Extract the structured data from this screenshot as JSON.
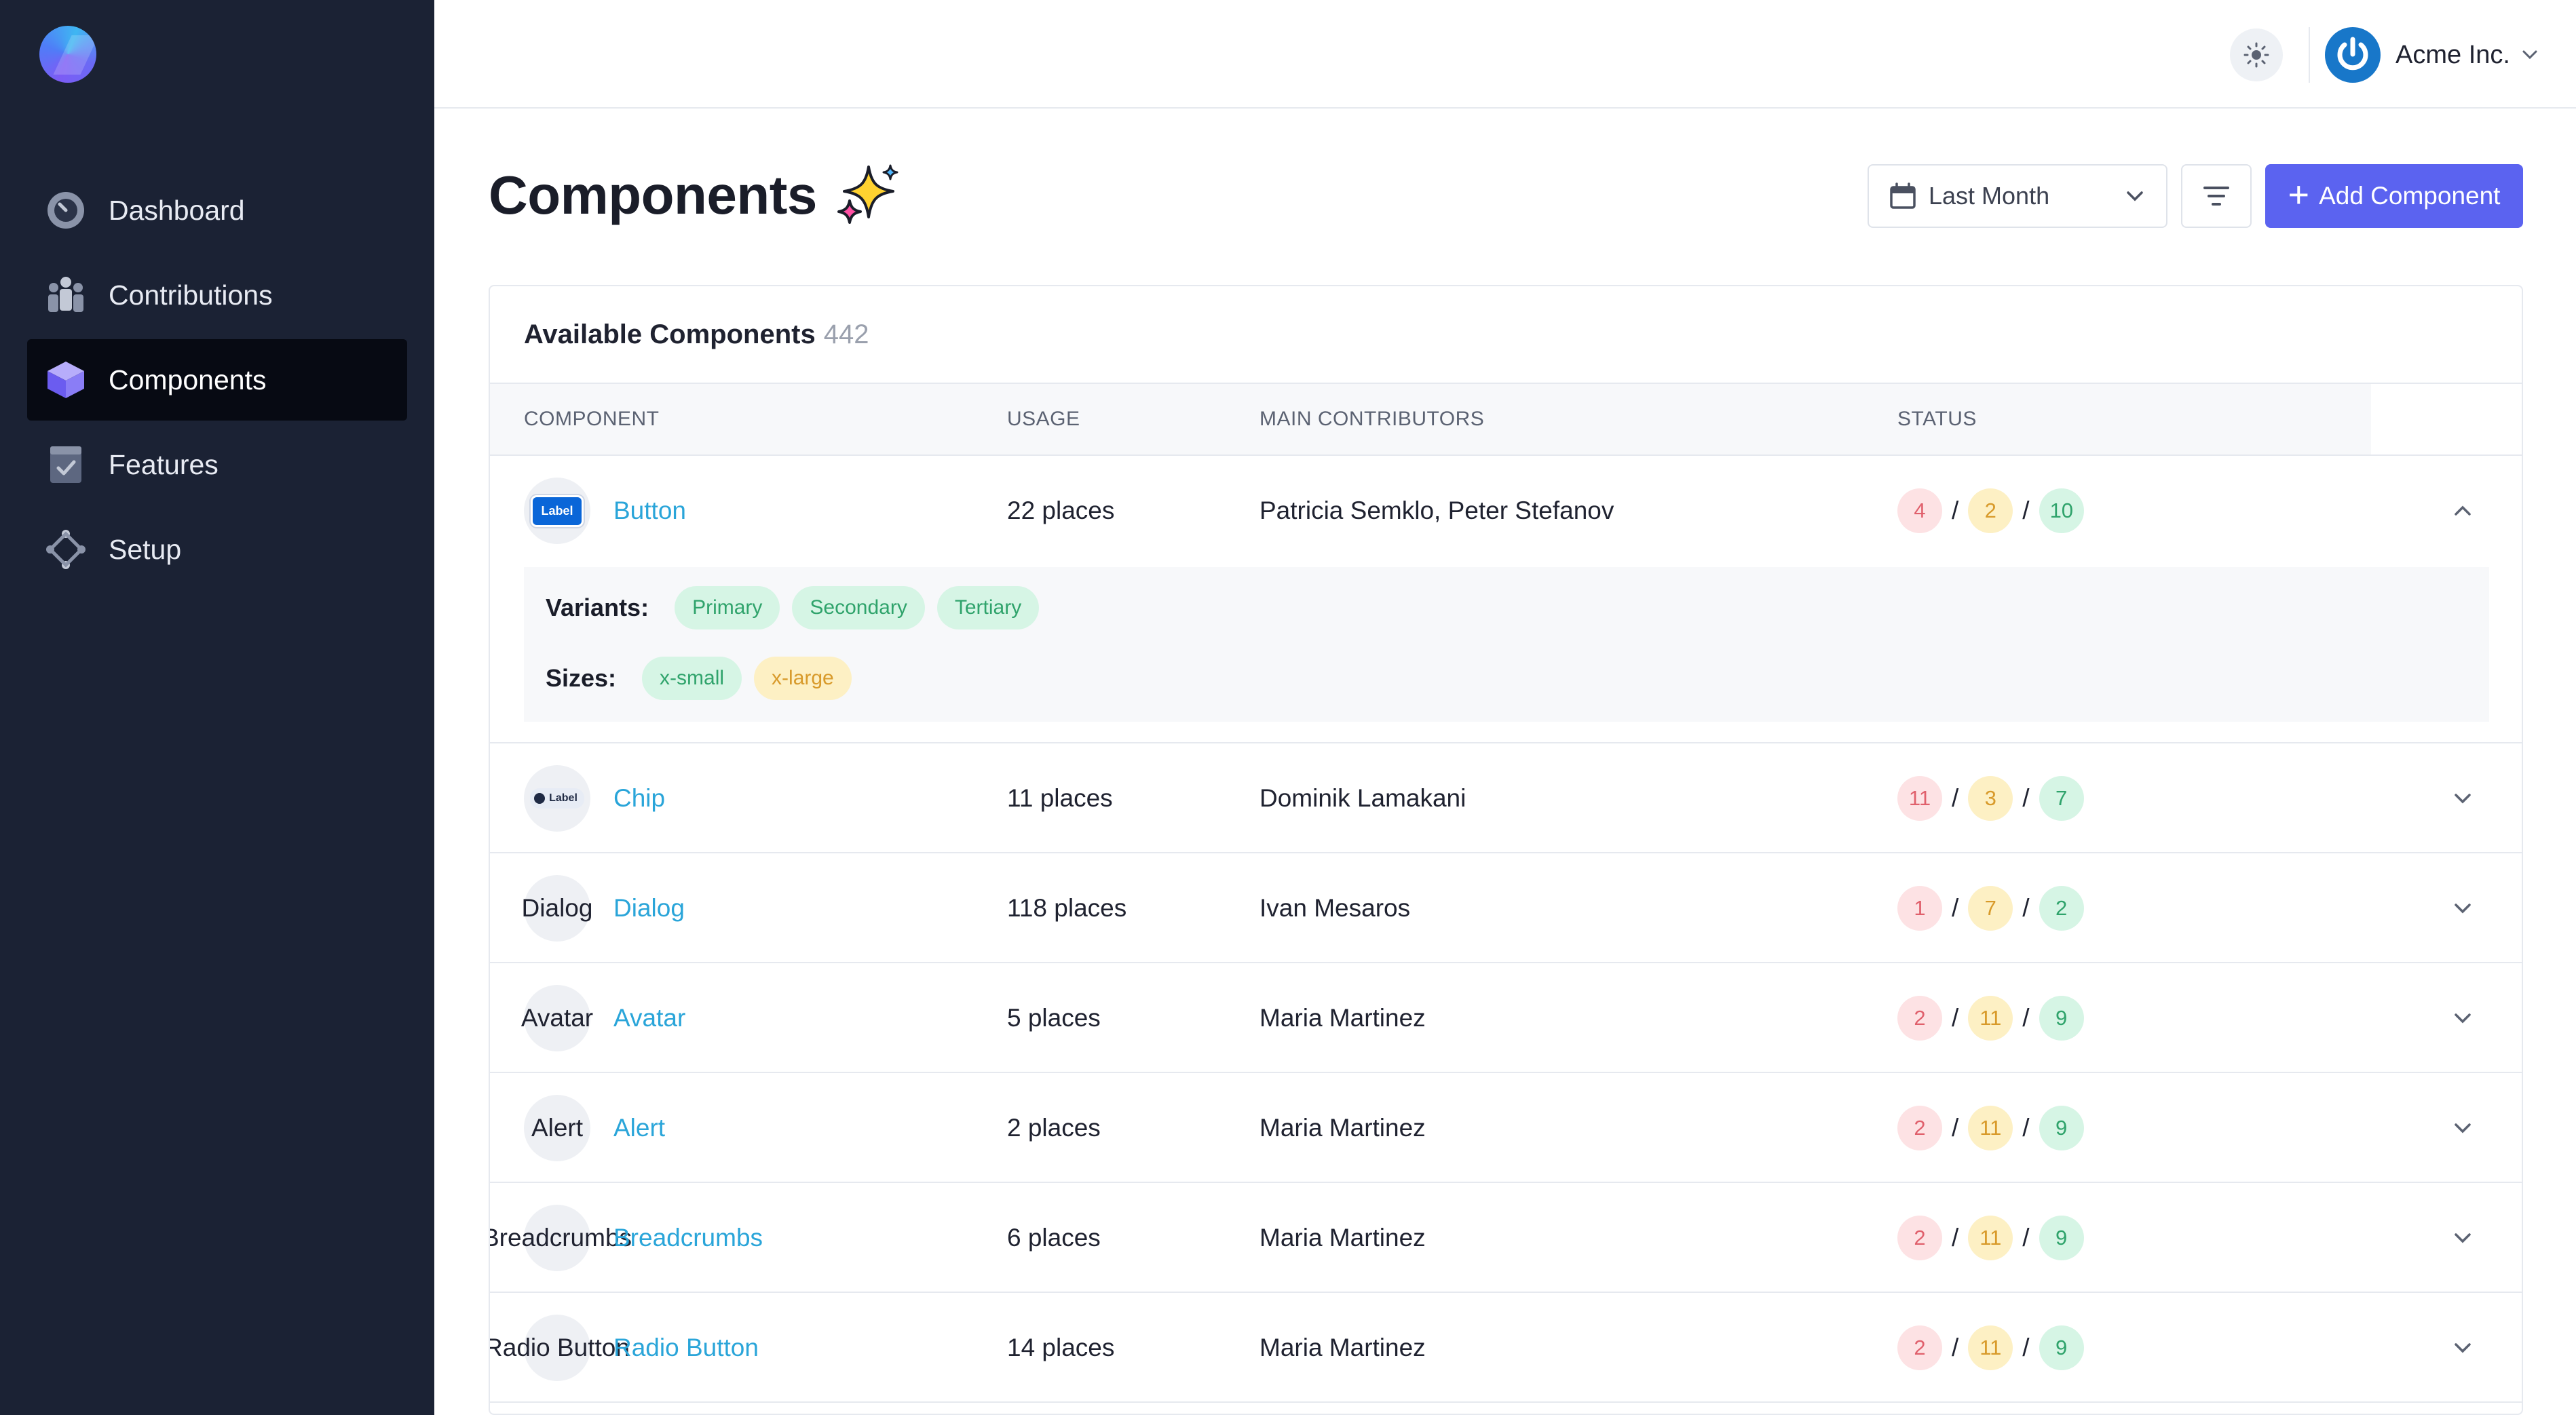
{
  "sidebar": {
    "items": [
      {
        "label": "Dashboard",
        "icon": "dashboard-gauge-icon",
        "active": false
      },
      {
        "label": "Contributions",
        "icon": "contributors-people-icon",
        "active": false
      },
      {
        "label": "Components",
        "icon": "components-cube-icon",
        "active": true
      },
      {
        "label": "Features",
        "icon": "features-checklist-icon",
        "active": false
      },
      {
        "label": "Setup",
        "icon": "setup-diamond-icon",
        "active": false
      }
    ]
  },
  "header": {
    "account_name": "Acme Inc."
  },
  "page": {
    "title": "Components",
    "date_filter": "Last Month",
    "add_button": "Add Component"
  },
  "card": {
    "title": "Available Components",
    "count": "442",
    "columns": {
      "component": "COMPONENT",
      "usage": "USAGE",
      "contributors": "MAIN CONTRIBUTORS",
      "status": "STATUS"
    },
    "rows": [
      {
        "thumb": "Label",
        "name": "Button",
        "usage": "22 places",
        "contributors": "Patricia Semklo, Peter Stefanov",
        "status": [
          "4",
          "2",
          "10"
        ],
        "expanded": true
      },
      {
        "thumb": "Label",
        "name": "Chip",
        "usage": "11 places",
        "contributors": "Dominik Lamakani",
        "status": [
          "11",
          "3",
          "7"
        ]
      },
      {
        "thumb": "Dialog",
        "name": "Dialog",
        "usage": "118 places",
        "contributors": "Ivan Mesaros",
        "status": [
          "1",
          "7",
          "2"
        ]
      },
      {
        "thumb": "Avatar",
        "name": "Avatar",
        "usage": "5 places",
        "contributors": "Maria Martinez",
        "status": [
          "2",
          "11",
          "9"
        ]
      },
      {
        "thumb": "Alert",
        "name": "Alert",
        "usage": "2 places",
        "contributors": "Maria Martinez",
        "status": [
          "2",
          "11",
          "9"
        ]
      },
      {
        "thumb": "Breadcrumbs",
        "name": "Breadcrumbs",
        "usage": "6 places",
        "contributors": "Maria Martinez",
        "status": [
          "2",
          "11",
          "9"
        ]
      },
      {
        "thumb": "Radio Button",
        "name": "Radio Button",
        "usage": "14 places",
        "contributors": "Maria Martinez",
        "status": [
          "2",
          "11",
          "9"
        ]
      }
    ],
    "expanded_details": {
      "variants_label": "Variants:",
      "variants": [
        "Primary",
        "Secondary",
        "Tertiary"
      ],
      "sizes_label": "Sizes:",
      "sizes": [
        "x-small",
        "x-large"
      ]
    }
  },
  "colors": {
    "sidebar_bg": "#1b2234",
    "accent": "#5b63f0",
    "link": "#2aa5d9",
    "status_red": "#e0606c",
    "status_yellow": "#d89a2a",
    "status_green": "#2fa36b"
  }
}
